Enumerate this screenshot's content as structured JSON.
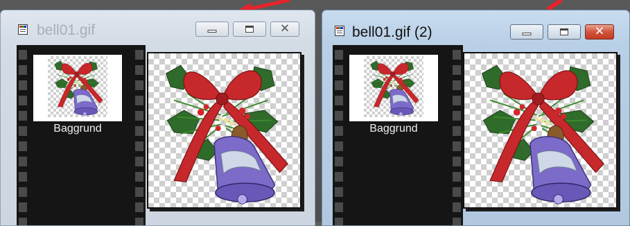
{
  "windows": [
    {
      "title": "bell01.gif",
      "state": "inactive",
      "layers": [
        {
          "label": "Baggrund"
        }
      ]
    },
    {
      "title": "bell01.gif (2)",
      "state": "active",
      "layers": [
        {
          "label": "Baggrund"
        }
      ]
    }
  ],
  "controls": {
    "minimize_icon": "minimize-icon",
    "maximize_icon": "maximize-icon",
    "close_icon": "close-icon",
    "close_glyph": "✕"
  },
  "image": {
    "icon": "christmas-bell-image",
    "transparency": "checkerboard"
  },
  "colors": {
    "arrow": "#e8232a",
    "active_titlebar": "#b8cfe6",
    "inactive_titlebar": "#d3dbe5",
    "close_button": "#c8462d",
    "layer_palette": "#151515"
  }
}
